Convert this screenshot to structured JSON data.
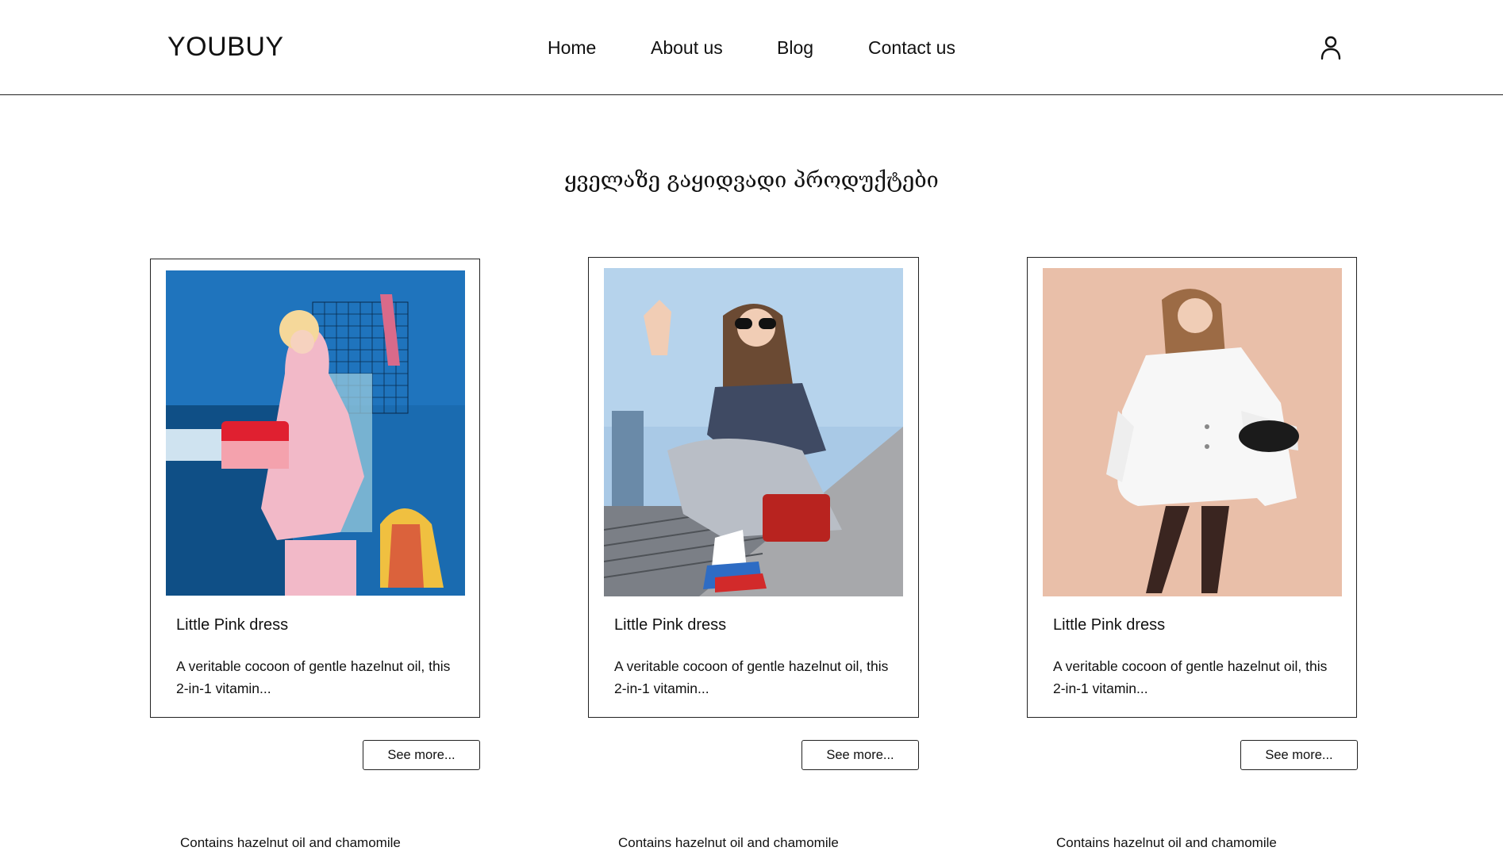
{
  "header": {
    "logo": "YOUBUY",
    "nav": [
      "Home",
      "About us",
      "Blog",
      "Contact us"
    ],
    "user_icon": "user-icon"
  },
  "section": {
    "title": "ყველაზე გაყიდვადი პროდუქტები"
  },
  "products": [
    {
      "title": "Little Pink dress",
      "description": "A veritable cocoon of gentle hazelnut oil, this 2-in-1 vitamin...",
      "button": "See more...",
      "below_text": "Contains hazelnut oil and chamomile",
      "photo": "woman in pink outfit with handbags on blue background"
    },
    {
      "title": "Little Pink dress",
      "description": "A veritable cocoon of gentle hazelnut oil, this 2-in-1 vitamin...",
      "button": "See more...",
      "below_text": "Contains hazelnut oil and chamomile",
      "photo": "woman in sunglasses with red bag crouching on stairs"
    },
    {
      "title": "Little Pink dress",
      "description": "A veritable cocoon of gentle hazelnut oil, this 2-in-1 vitamin...",
      "button": "See more...",
      "below_text": "Contains hazelnut oil and chamomile",
      "photo": "woman in white coat with black bag on peach background"
    }
  ]
}
